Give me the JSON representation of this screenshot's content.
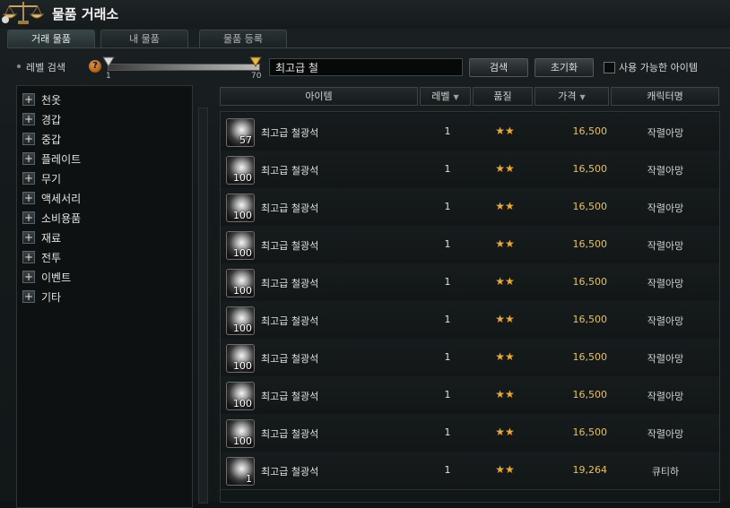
{
  "window": {
    "title": "물품 거래소"
  },
  "tabs": [
    {
      "label": "거래 물품",
      "active": true
    },
    {
      "label": "내 물품",
      "active": false
    },
    {
      "label": "물품 등록",
      "active": false
    }
  ],
  "search": {
    "level_label": "레벨 검색",
    "level_min": "1",
    "level_max": "70",
    "query": "최고급 철",
    "search_button": "검색",
    "reset_button": "초기화",
    "usable_only_label": "사용 가능한 아이템",
    "usable_only_checked": false
  },
  "categories": [
    {
      "label": "천옷"
    },
    {
      "label": "경갑"
    },
    {
      "label": "중갑"
    },
    {
      "label": "플레이트"
    },
    {
      "label": "무기"
    },
    {
      "label": "액세서리"
    },
    {
      "label": "소비용품"
    },
    {
      "label": "재료"
    },
    {
      "label": "전투"
    },
    {
      "label": "이벤트"
    },
    {
      "label": "기타"
    }
  ],
  "table": {
    "headers": {
      "item": "아이템",
      "level": "레벨",
      "quality": "품질",
      "price": "가격",
      "seller": "캐릭터명"
    },
    "rows": [
      {
        "count": "57",
        "name": "최고급 철광석",
        "level": "1",
        "quality": "★★",
        "price": "16,500",
        "seller": "작렬아망"
      },
      {
        "count": "100",
        "name": "최고급 철광석",
        "level": "1",
        "quality": "★★",
        "price": "16,500",
        "seller": "작렬아망"
      },
      {
        "count": "100",
        "name": "최고급 철광석",
        "level": "1",
        "quality": "★★",
        "price": "16,500",
        "seller": "작렬아망"
      },
      {
        "count": "100",
        "name": "최고급 철광석",
        "level": "1",
        "quality": "★★",
        "price": "16,500",
        "seller": "작렬아망"
      },
      {
        "count": "100",
        "name": "최고급 철광석",
        "level": "1",
        "quality": "★★",
        "price": "16,500",
        "seller": "작렬아망"
      },
      {
        "count": "100",
        "name": "최고급 철광석",
        "level": "1",
        "quality": "★★",
        "price": "16,500",
        "seller": "작렬아망"
      },
      {
        "count": "100",
        "name": "최고급 철광석",
        "level": "1",
        "quality": "★★",
        "price": "16,500",
        "seller": "작렬아망"
      },
      {
        "count": "100",
        "name": "최고급 철광석",
        "level": "1",
        "quality": "★★",
        "price": "16,500",
        "seller": "작렬아망"
      },
      {
        "count": "100",
        "name": "최고급 철광석",
        "level": "1",
        "quality": "★★",
        "price": "16,500",
        "seller": "작렬아망"
      },
      {
        "count": "1",
        "name": "최고급 철광석",
        "level": "1",
        "quality": "★★",
        "price": "19,264",
        "seller": "큐티하"
      }
    ]
  },
  "icons": {
    "title_icon": "scale-icon",
    "help_icon": "help-icon",
    "category_expand": "plus-icon",
    "sort": "chevron-down-icon",
    "item": "iron-ore-icon"
  },
  "colors": {
    "price": "#e8c060",
    "quality_star": "#f0a830"
  }
}
